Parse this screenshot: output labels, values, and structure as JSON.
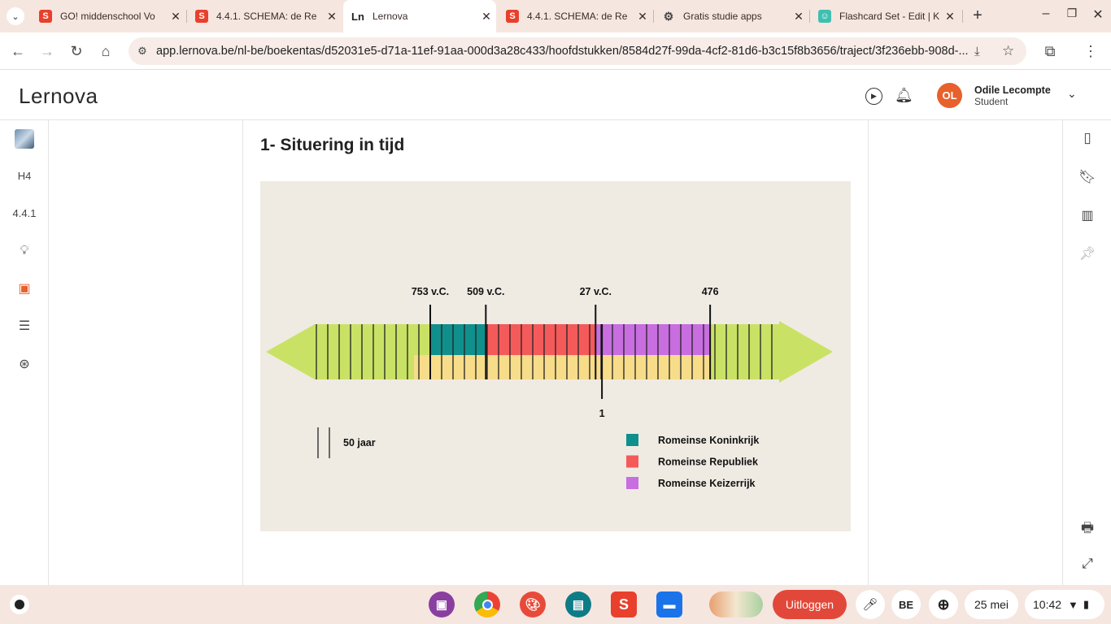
{
  "browser": {
    "tabs": [
      {
        "title": "GO! middenschool Vo",
        "icon": "smartschool-icon",
        "color": "#e8402c",
        "glyph": "S"
      },
      {
        "title": "4.4.1. SCHEMA: de Re",
        "icon": "smartschool-icon",
        "color": "#e8402c",
        "glyph": "S"
      },
      {
        "title": "Lernova",
        "icon": "lernova-icon",
        "color": "#ffffff",
        "glyph": "Ln"
      },
      {
        "title": "4.4.1. SCHEMA: de Re",
        "icon": "smartschool-icon",
        "color": "#e8402c",
        "glyph": "S"
      },
      {
        "title": "Gratis studie apps",
        "icon": "gear-icon",
        "color": "#ffffff",
        "glyph": "⚙"
      },
      {
        "title": "Flashcard Set - Edit | K",
        "icon": "flashcard-icon",
        "color": "#3fbfb0",
        "glyph": "☺"
      }
    ],
    "url": "app.lernova.be/nl-be/boekentas/d52031e5-d71a-11ef-91aa-000d3a28c433/hoofdstukken/8584d27f-99da-4cf2-81d6-b3c15f8b3656/traject/3f236ebb-908d-..."
  },
  "app": {
    "logo_text": "Lernova",
    "user": {
      "initials": "OL",
      "name": "Odile Lecompte",
      "role": "Student",
      "avatar_color": "#e8602c"
    }
  },
  "leftrail": {
    "chapter": "H4",
    "section": "4.4.1"
  },
  "content": {
    "heading": "1- Situering in tijd"
  },
  "chart_data": {
    "type": "timeline",
    "events": [
      {
        "label": "753 v.C.",
        "year": -753
      },
      {
        "label": "509 v.C.",
        "year": -509
      },
      {
        "label": "27 v.C.",
        "year": -27
      },
      {
        "label": "1",
        "year": 1
      },
      {
        "label": "476",
        "year": 476
      }
    ],
    "tick_interval_label": "50 jaar",
    "series": [
      {
        "name": "Romeinse Koninkrijk",
        "start": -753,
        "end": -509,
        "color": "#10908c"
      },
      {
        "name": "Romeinse Republiek",
        "start": -509,
        "end": -27,
        "color": "#f55a5a"
      },
      {
        "name": "Romeinse Keizerrijk",
        "start": -27,
        "end": 476,
        "color": "#c86ee0"
      }
    ],
    "colors": {
      "arrow": "#c9e265",
      "lower_band": "#f7dc8a",
      "background": "#efebe3"
    }
  },
  "shelf": {
    "logout_label": "Uitloggen",
    "keyboard": "BE",
    "date": "25 mei",
    "time": "10:42"
  }
}
